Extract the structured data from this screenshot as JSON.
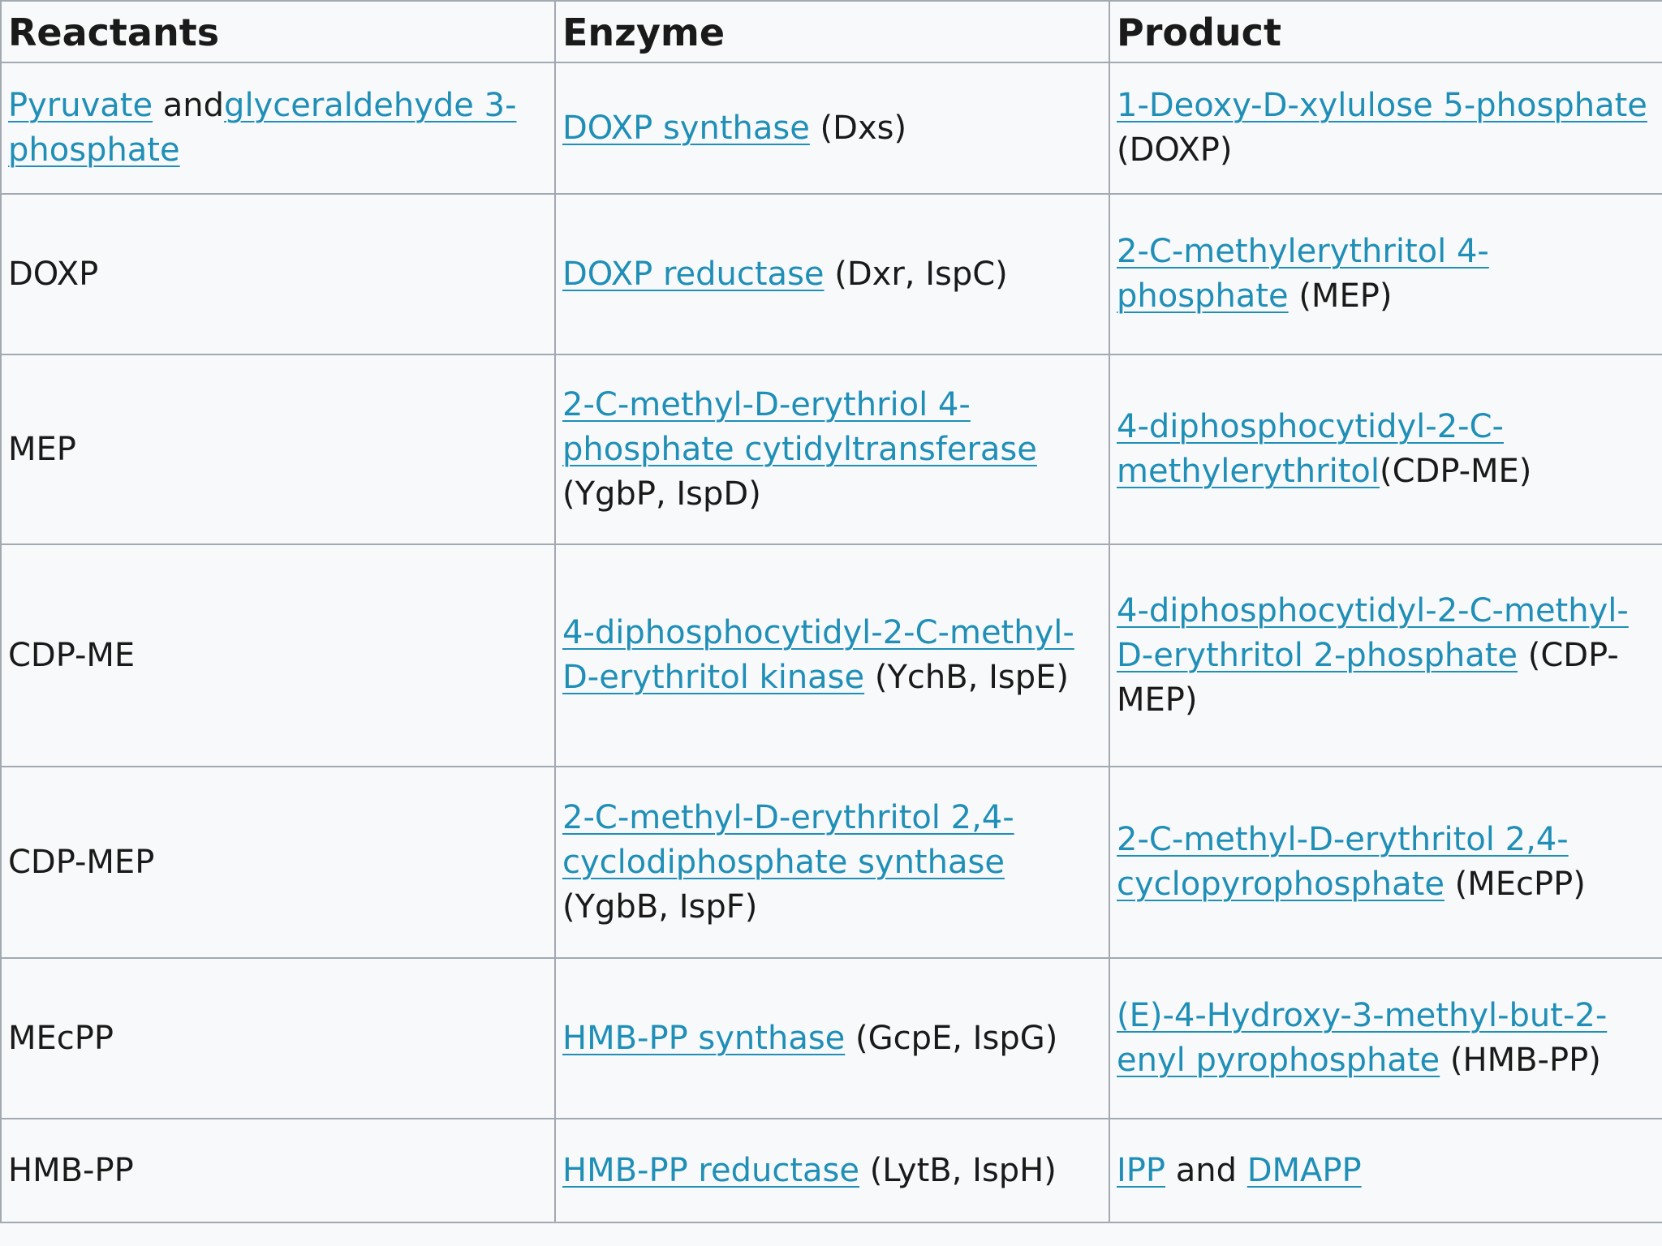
{
  "headers": {
    "reactants": "Reactants",
    "enzyme": "Enzyme",
    "product": "Product"
  },
  "rows": [
    {
      "reactants": {
        "link1": "Pyruvate",
        "mid": " and",
        "link2": "glyceraldehyde 3-phosphate"
      },
      "enzyme": {
        "link": "DOXP synthase",
        "rest": " (Dxs)"
      },
      "product": {
        "link": "1-Deoxy-D-xylulose 5-phosphate",
        "rest": " (DOXP)"
      }
    },
    {
      "reactants": {
        "text": "DOXP"
      },
      "enzyme": {
        "link": "DOXP reductase",
        "rest": " (Dxr, IspC)"
      },
      "product": {
        "link": "2-C-methylerythritol 4-phosphate",
        "rest": " (MEP)"
      }
    },
    {
      "reactants": {
        "text": "MEP"
      },
      "enzyme": {
        "link": "2-C-methyl-D-erythriol 4-phosphate cytidyltransferase",
        "rest": " (YgbP, IspD)"
      },
      "product": {
        "link": "4-diphosphocytidyl-2-C-methylerythritol",
        "rest": "(CDP-ME)"
      }
    },
    {
      "reactants": {
        "text": "CDP-ME"
      },
      "enzyme": {
        "link": "4-diphosphocytidyl-2-C-methyl-D-erythritol kinase",
        "rest": " (YchB, IspE)"
      },
      "product": {
        "link": "4-diphosphocytidyl-2-C-methyl-D-erythritol 2-phosphate",
        "rest": " (CDP-MEP)"
      }
    },
    {
      "reactants": {
        "text": "CDP-MEP"
      },
      "enzyme": {
        "link": "2-C-methyl-D-erythritol 2,4-cyclodiphosphate synthase",
        "rest": " (YgbB, IspF)"
      },
      "product": {
        "link": "2-C-methyl-D-erythritol 2,4-cyclopyrophosphate",
        "rest": " (MEcPP)"
      }
    },
    {
      "reactants": {
        "text": "MEcPP"
      },
      "enzyme": {
        "link": "HMB-PP synthase",
        "rest": " (GcpE, IspG)"
      },
      "product": {
        "link": "(E)-4-Hydroxy-3-methyl-but-2-enyl pyrophosphate",
        "rest": " (HMB-PP)"
      }
    },
    {
      "reactants": {
        "text": "HMB-PP"
      },
      "enzyme": {
        "link": "HMB-PP reductase",
        "rest": " (LytB, IspH)"
      },
      "product": {
        "link1": "IPP",
        "mid": " and ",
        "link2": "DMAPP"
      }
    }
  ],
  "colors": {
    "link": "#1f8fb8",
    "border": "#a2a9b1",
    "background": "#f8f9fa",
    "text": "#1a1a1a"
  }
}
